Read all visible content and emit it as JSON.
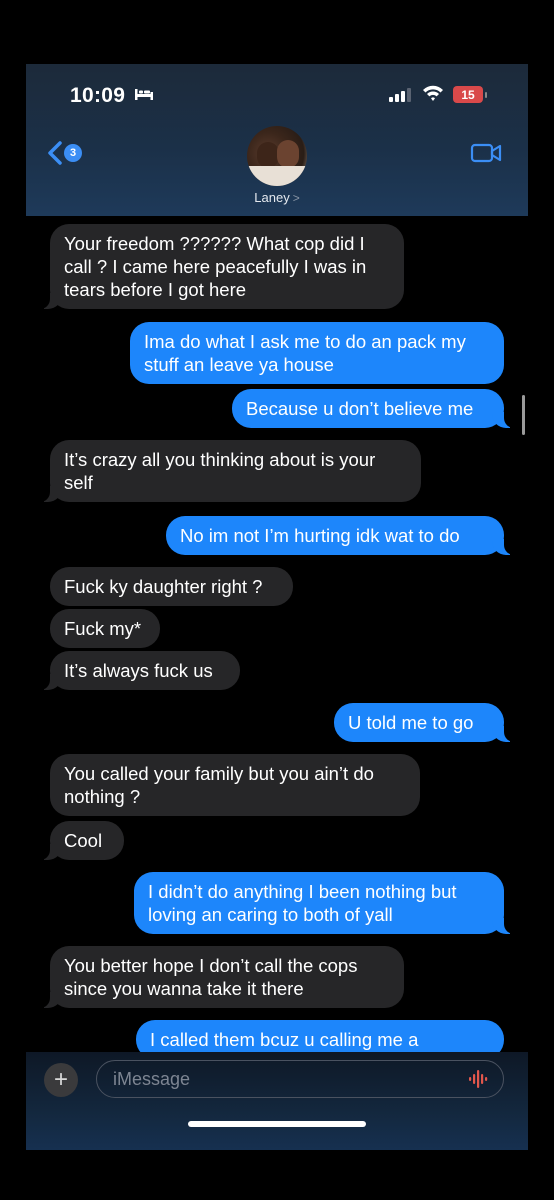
{
  "status_bar": {
    "time": "10:09",
    "battery": "15"
  },
  "header": {
    "back_badge": "3",
    "contact_name": "Laney",
    "name_chevron": ">"
  },
  "messages": [
    {
      "from": "them",
      "text": "Your freedom ?????? What cop did I call ? I came here peacefully I was in tears before I got here"
    },
    {
      "from": "me",
      "text": "Ima do what I ask me to do an pack my stuff an leave ya house"
    },
    {
      "from": "me",
      "text": "Because u don’t believe me"
    },
    {
      "from": "them",
      "text": "It’s crazy all you thinking about is your self"
    },
    {
      "from": "me",
      "text": "No im not I’m hurting idk wat to do"
    },
    {
      "from": "them",
      "text": "Fuck ky daughter right ?"
    },
    {
      "from": "them",
      "text": "Fuck my*"
    },
    {
      "from": "them",
      "text": "It’s always fuck us"
    },
    {
      "from": "me",
      "text": "U told me to go"
    },
    {
      "from": "them",
      "text": "You called your family but you ain’t do nothing ?"
    },
    {
      "from": "them",
      "text": "Cool"
    },
    {
      "from": "me",
      "text": "I didn’t do anything I been nothing but loving an caring to both of yall"
    },
    {
      "from": "them",
      "text": "You better hope I don’t call the cops since you wanna take it there"
    },
    {
      "from": "me",
      "text": "I called them bcuz u calling me a"
    }
  ],
  "composer": {
    "plus": "+",
    "placeholder": "iMessage"
  },
  "colors": {
    "outgoing": "#1d86fb",
    "incoming": "#262628",
    "battery": "#d9494a"
  }
}
